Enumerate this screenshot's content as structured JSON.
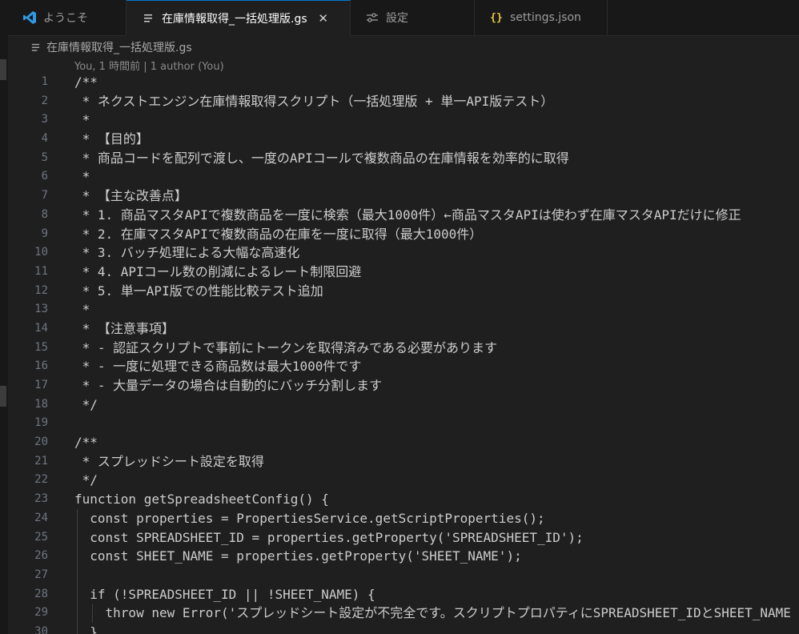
{
  "tabs": [
    {
      "icon": "vscode-logo-icon",
      "label": "ようこそ",
      "active": false
    },
    {
      "icon": "file-lines-icon",
      "label": "在庫情報取得_一括処理版.gs",
      "active": true,
      "close": "✕"
    },
    {
      "icon": "settings-sliders-icon",
      "label": "設定",
      "active": false
    },
    {
      "icon": "json-braces-icon",
      "label": "settings.json",
      "active": false,
      "glyph": "{}"
    }
  ],
  "breadcrumb": {
    "file": "在庫情報取得_一括処理版.gs"
  },
  "blame": "You, 1 時間前 | 1 author (You)",
  "editor": {
    "lines": [
      {
        "n": "1",
        "text": "/**"
      },
      {
        "n": "2",
        "text": " * ネクストエンジン在庫情報取得スクリプト（一括処理版 + 単一API版テスト）"
      },
      {
        "n": "3",
        "text": " *"
      },
      {
        "n": "4",
        "text": " * 【目的】"
      },
      {
        "n": "5",
        "text": " * 商品コードを配列で渡し、一度のAPIコールで複数商品の在庫情報を効率的に取得"
      },
      {
        "n": "6",
        "text": " *"
      },
      {
        "n": "7",
        "text": " * 【主な改善点】"
      },
      {
        "n": "8",
        "text": " * 1. 商品マスタAPIで複数商品を一度に検索（最大1000件）←商品マスタAPIは使わず在庫マスタAPIだけに修正"
      },
      {
        "n": "9",
        "text": " * 2. 在庫マスタAPIで複数商品の在庫を一度に取得（最大1000件）"
      },
      {
        "n": "10",
        "text": " * 3. バッチ処理による大幅な高速化"
      },
      {
        "n": "11",
        "text": " * 4. APIコール数の削減によるレート制限回避"
      },
      {
        "n": "12",
        "text": " * 5. 単一API版での性能比較テスト追加"
      },
      {
        "n": "13",
        "text": " *"
      },
      {
        "n": "14",
        "text": " * 【注意事項】"
      },
      {
        "n": "15",
        "text": " * - 認証スクリプトで事前にトークンを取得済みである必要があります"
      },
      {
        "n": "16",
        "text": " * - 一度に処理できる商品数は最大1000件です"
      },
      {
        "n": "17",
        "text": " * - 大量データの場合は自動的にバッチ分割します"
      },
      {
        "n": "18",
        "text": " */"
      },
      {
        "n": "19",
        "text": ""
      },
      {
        "n": "20",
        "text": "/**"
      },
      {
        "n": "21",
        "text": " * スプレッドシート設定を取得"
      },
      {
        "n": "22",
        "text": " */"
      },
      {
        "n": "23",
        "text": "function getSpreadsheetConfig() {"
      },
      {
        "n": "24",
        "text": "  const properties = PropertiesService.getScriptProperties();"
      },
      {
        "n": "25",
        "text": "  const SPREADSHEET_ID = properties.getProperty('SPREADSHEET_ID');"
      },
      {
        "n": "26",
        "text": "  const SHEET_NAME = properties.getProperty('SHEET_NAME');"
      },
      {
        "n": "27",
        "text": ""
      },
      {
        "n": "28",
        "text": "  if (!SPREADSHEET_ID || !SHEET_NAME) {"
      },
      {
        "n": "29",
        "text": "    throw new Error('スプレッドシート設定が不完全です。スクリプトプロパティにSPREADSHEET_IDとSHEET_NAME"
      },
      {
        "n": "30",
        "text": "  }"
      }
    ]
  },
  "colors": {
    "background": "#1f1f1f",
    "tab_bar": "#181818",
    "active_tab_border": "#0078d4",
    "vscode_logo": "#2f9ae3",
    "json_icon": "#e8c840",
    "line_number": "#6e7681"
  }
}
